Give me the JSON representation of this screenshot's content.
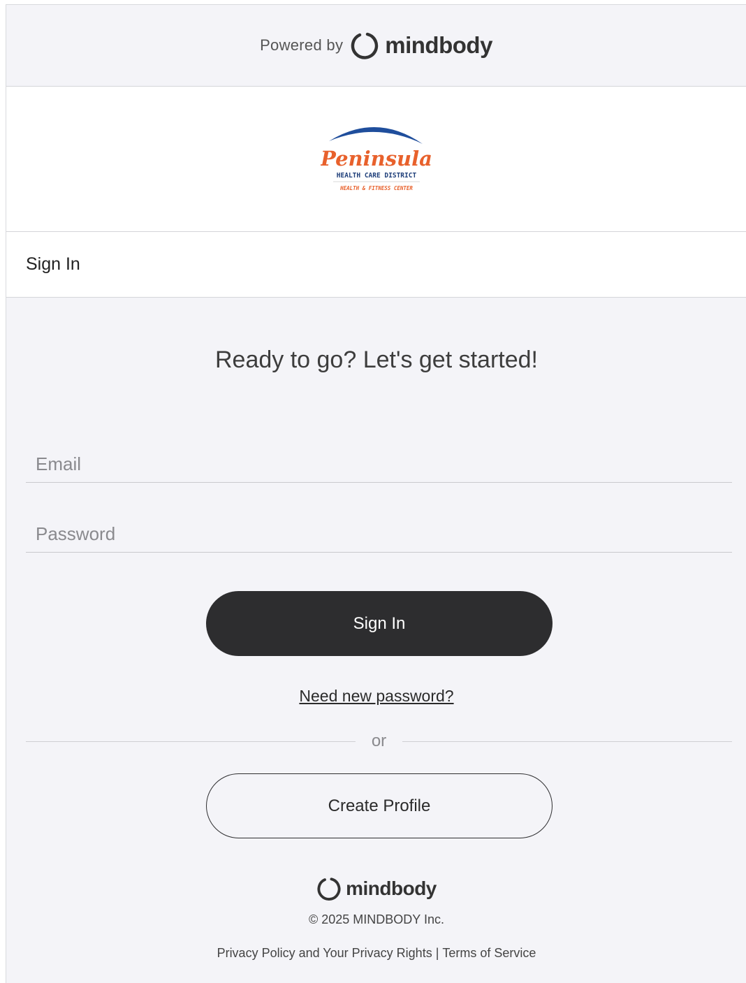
{
  "powered_by": {
    "label": "Powered by",
    "brand_name": "mindbody"
  },
  "business_logo": {
    "script_word": "Peninsula",
    "line1": "HEALTH CARE DISTRICT",
    "line2": "HEALTH & FITNESS CENTER",
    "colors": {
      "arc": "#1f4e9c",
      "script": "#e8612c",
      "line1": "#1f3f7a",
      "line2": "#e8612c"
    }
  },
  "page_header": {
    "title": "Sign In"
  },
  "form": {
    "headline": "Ready to go? Let's get started!",
    "email_placeholder": "Email",
    "email_value": "",
    "password_placeholder": "Password",
    "password_value": "",
    "submit_label": "Sign In",
    "forgot_link": "Need new password?",
    "divider_text": "or",
    "create_profile_label": "Create Profile"
  },
  "footer": {
    "brand_name": "mindbody",
    "copyright": "© 2025 MINDBODY Inc.",
    "privacy_link": "Privacy Policy and Your Privacy Rights",
    "separator": "|",
    "terms_link": "Terms of Service"
  },
  "icons": {
    "mindbody_logo": "mindbody-ring-icon"
  }
}
